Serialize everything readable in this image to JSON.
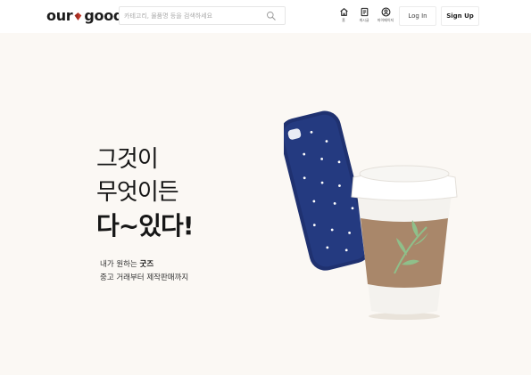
{
  "header": {
    "logo": {
      "part1": "our",
      "part2": "goods"
    },
    "search": {
      "placeholder": "카테고리, 물품명 등을 검색하세요",
      "value": ""
    },
    "nav": [
      {
        "label": "홈",
        "icon": "home-icon"
      },
      {
        "label": "게시글",
        "icon": "document-icon"
      },
      {
        "label": "마이페이지",
        "icon": "user-circle-icon"
      }
    ],
    "login_label": "Log In",
    "signup_label": "Sign Up"
  },
  "hero": {
    "headline": [
      "그것이",
      "무엇이든",
      "다~있다!"
    ],
    "sub_line1_prefix": "내가 원하는 ",
    "sub_line1_emphasis": "굿즈",
    "sub_line2": "중고 거래부터 제작판매까지"
  },
  "colors": {
    "logo_heart": "#c0392b",
    "hero_bg": "#fbf8f4",
    "phone_case": "#1f3170",
    "cup_sleeve": "#a9876a",
    "leaf": "#8fbf8a"
  }
}
